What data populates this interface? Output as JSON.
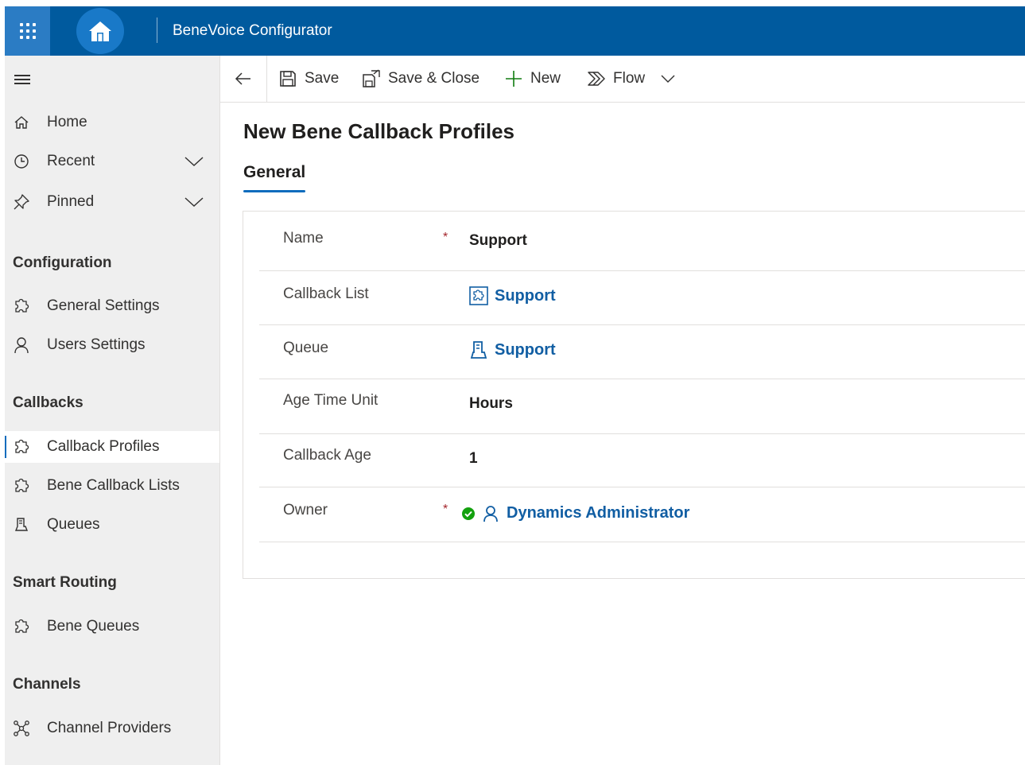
{
  "app": {
    "title": "BeneVoice Configurator"
  },
  "sidebar": {
    "top_items": [
      {
        "label": "Home",
        "icon": "home-icon"
      },
      {
        "label": "Recent",
        "icon": "clock-icon"
      },
      {
        "label": "Pinned",
        "icon": "pin-icon"
      }
    ],
    "groups": [
      {
        "title": "Configuration",
        "items": [
          {
            "label": "General Settings",
            "icon": "puzzle-icon"
          },
          {
            "label": "Users Settings",
            "icon": "person-icon"
          }
        ]
      },
      {
        "title": "Callbacks",
        "items": [
          {
            "label": "Callback Profiles",
            "icon": "puzzle-icon",
            "active": true
          },
          {
            "label": "Bene Callback Lists",
            "icon": "puzzle-icon"
          },
          {
            "label": "Queues",
            "icon": "queue-icon"
          }
        ]
      },
      {
        "title": "Smart Routing",
        "items": [
          {
            "label": "Bene Queues",
            "icon": "puzzle-icon"
          }
        ]
      },
      {
        "title": "Channels",
        "items": [
          {
            "label": "Channel Providers",
            "icon": "network-icon"
          }
        ]
      }
    ]
  },
  "commandbar": {
    "save": "Save",
    "save_close": "Save & Close",
    "new": "New",
    "flow": "Flow"
  },
  "form": {
    "title": "New Bene Callback Profiles",
    "tab": "General",
    "fields": {
      "name": {
        "label": "Name",
        "required": "*",
        "value": "Support"
      },
      "callback_list": {
        "label": "Callback List",
        "value": "Support"
      },
      "queue": {
        "label": "Queue",
        "value": "Support"
      },
      "age_time_unit": {
        "label": "Age Time Unit",
        "value": "Hours"
      },
      "callback_age": {
        "label": "Callback Age",
        "value": "1"
      },
      "owner": {
        "label": "Owner",
        "required": "*",
        "value": "Dynamics Administrator"
      }
    }
  },
  "colors": {
    "header": "#005a9e",
    "accent": "#0f6cbd",
    "link": "#115ea3",
    "required": "#a4262c",
    "status_ok": "#13a10e"
  }
}
